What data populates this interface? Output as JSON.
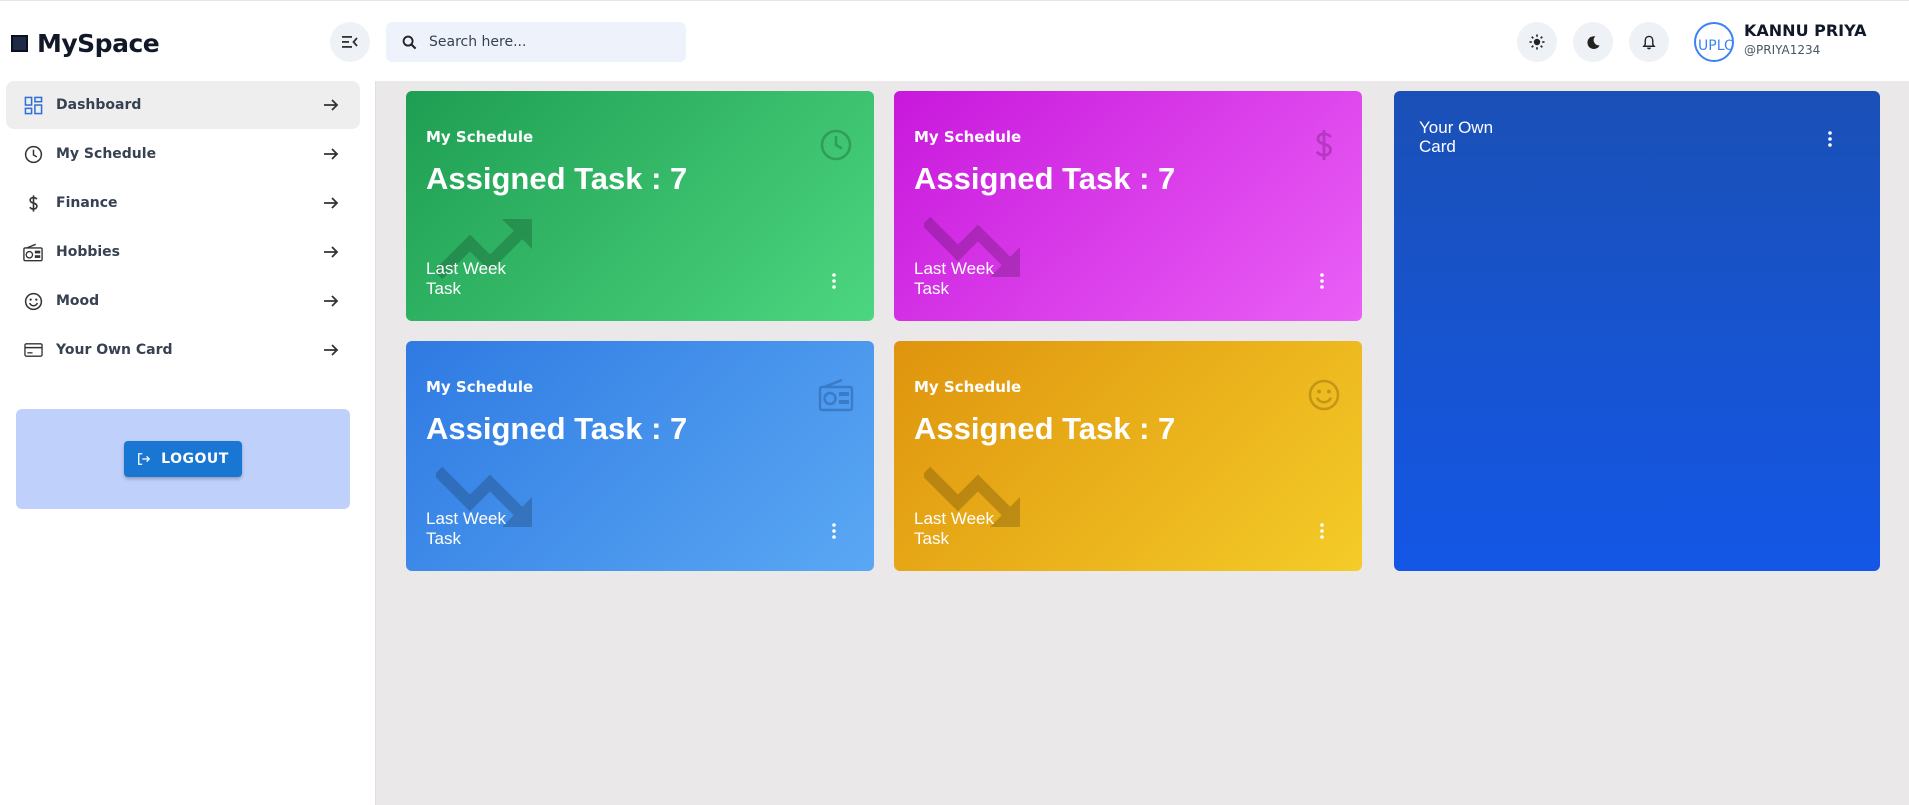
{
  "brand": {
    "name": "MySpace"
  },
  "search": {
    "placeholder": "Search here..."
  },
  "user": {
    "name": "KANNU PRIYA",
    "handle": "@PRIYA1234",
    "avatar_alt": "UPLO"
  },
  "sidebar": {
    "items": [
      {
        "label": "Dashboard",
        "icon": "dashboard-icon",
        "active": true
      },
      {
        "label": "My Schedule",
        "icon": "clock-icon"
      },
      {
        "label": "Finance",
        "icon": "dollar-icon"
      },
      {
        "label": "Hobbies",
        "icon": "radio-icon"
      },
      {
        "label": "Mood",
        "icon": "smiley-icon"
      },
      {
        "label": "Your Own Card",
        "icon": "card-icon"
      }
    ],
    "logout_label": "LOGOUT"
  },
  "cards": [
    {
      "small_title": "My Schedule",
      "big_title": "Assigned Task : 7",
      "footer": "Last Week Task",
      "icon": "clock-icon",
      "trend": "trending-up-icon",
      "color": "#1e9e52"
    },
    {
      "small_title": "My Schedule",
      "big_title": "Assigned Task : 7",
      "footer": "Last Week Task",
      "icon": "dollar-icon",
      "trend": "trending-down-icon",
      "color": "#c818dc"
    },
    {
      "small_title": "My Schedule",
      "big_title": "Assigned Task : 7",
      "footer": "Last Week Task",
      "icon": "radio-icon",
      "trend": "trending-down-icon",
      "color": "#2f7ae2"
    },
    {
      "small_title": "My Schedule",
      "big_title": "Assigned Task : 7",
      "footer": "Last Week Task",
      "icon": "smiley-icon",
      "trend": "trending-down-icon",
      "color": "#df940e"
    }
  ],
  "own_card": {
    "title": "Your Own Card",
    "color": "#1457e6"
  },
  "colors": {
    "accent": "#1976d2",
    "logout_panel": "#bfd1fb",
    "main_bg": "#eae8e9"
  }
}
